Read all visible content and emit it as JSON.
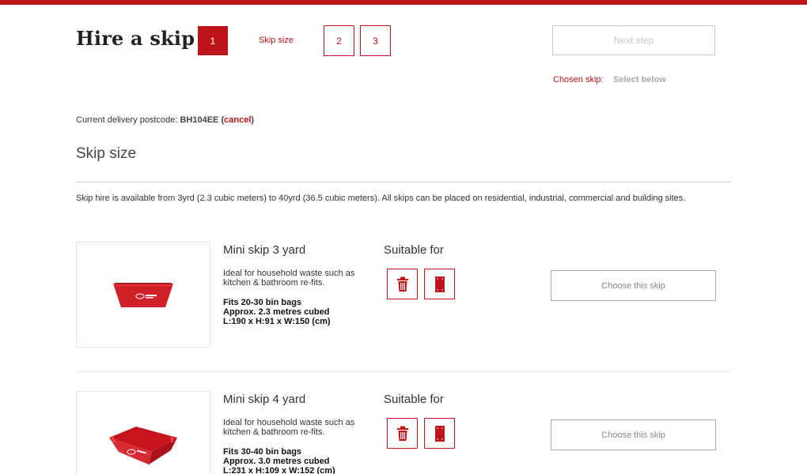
{
  "page": {
    "title": "Hire a skip",
    "accent_color": "#c0141b"
  },
  "steps": {
    "step1": "1",
    "step1_label": "Skip size",
    "step2": "2",
    "step3": "3"
  },
  "next_step_label": "Next step",
  "chosen": {
    "label": "Chosen skip:",
    "value": "Select below"
  },
  "postcode": {
    "prefix": "Current delivery postcode:",
    "code": "BH104EE",
    "open": "(",
    "cancel_label": "cancel",
    "close": ")"
  },
  "section_title": "Skip size",
  "intro_text": "Skip hire is available from 3yrd (2.3 cubic meters) to 40yrd (36.5 cubic meters). All skips can be placed on residential, industrial, commercial and building sites.",
  "skips": [
    {
      "name": "Mini skip 3 yard",
      "description": "Ideal for household waste such as kitchen & bathroom re-fits.",
      "spec1": "Fits 20-30 bin bags",
      "spec2": "Approx. 2.3 metres cubed",
      "spec3": "L:190 x H:91 x W:150 (cm)",
      "suitable_label": "Suitable for",
      "suitable_icons": [
        "bin-icon",
        "door-icon"
      ],
      "choose_label": "Choose this skip"
    },
    {
      "name": "Mini skip 4 yard",
      "description": "Ideal for household waste such as kitchen & bathroom re-fits.",
      "spec1": "Fits 30-40 bin bags",
      "spec2": "Approx. 3.0 metres cubed",
      "spec3": "L:231 x H:109 x W:152 (cm)",
      "suitable_label": "Suitable for",
      "suitable_icons": [
        "bin-icon",
        "door-icon"
      ],
      "choose_label": "Choose this skip"
    }
  ]
}
